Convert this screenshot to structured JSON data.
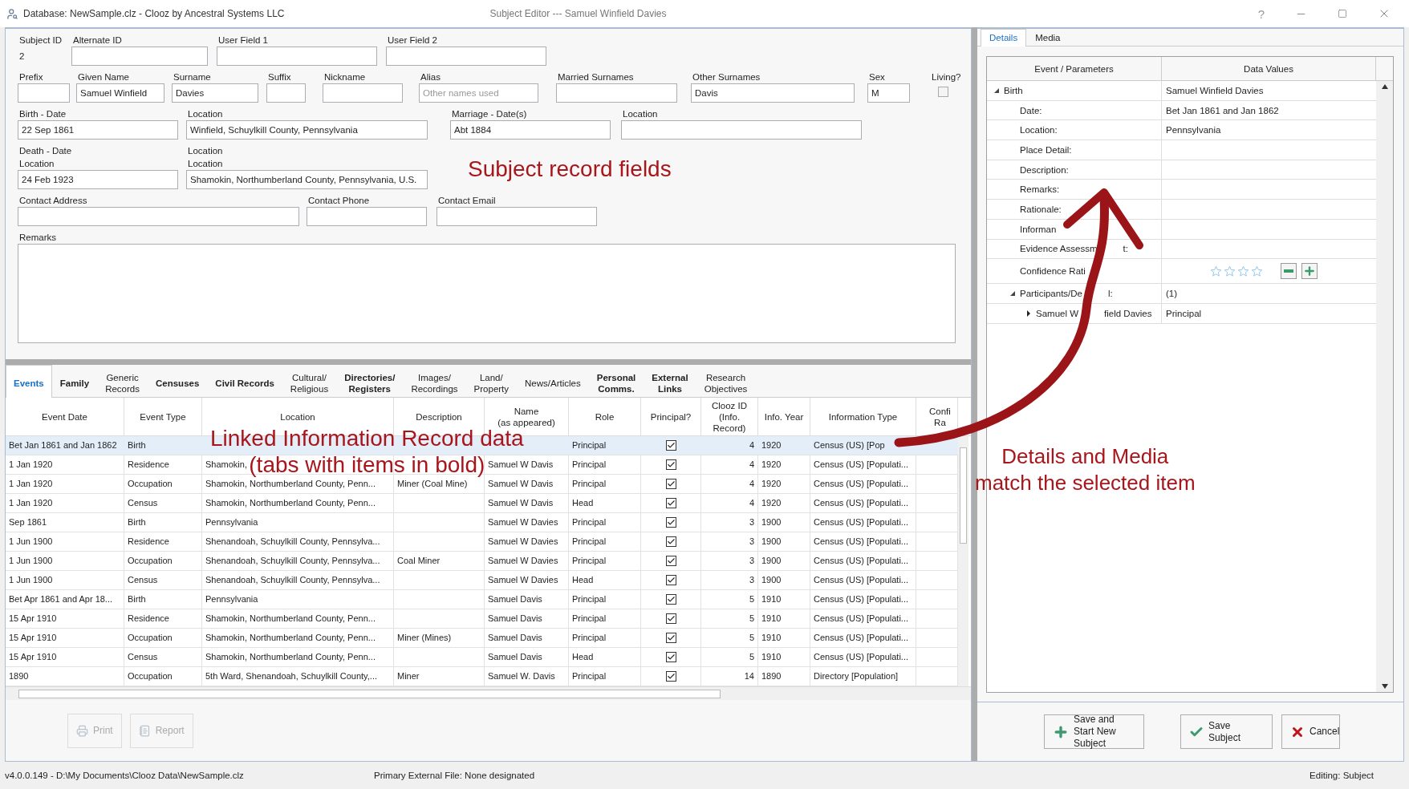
{
  "window": {
    "title": "Database: NewSample.clz - Clooz by Ancestral Systems LLC",
    "subtitle": "Subject Editor --- Samuel Winfield Davies",
    "help": "?"
  },
  "subject_form": {
    "rows": [
      [
        {
          "kind": "static",
          "label": "Subject ID",
          "value": "2"
        },
        {
          "kind": "text",
          "label": "Alternate ID"
        },
        {
          "kind": "text",
          "label": "User Field 1"
        },
        {
          "kind": "text",
          "label": "User Field 2"
        }
      ],
      [
        {
          "kind": "text",
          "label": "Prefix"
        },
        {
          "kind": "text",
          "label": "Given Name",
          "value": "Samuel Winfield"
        },
        {
          "kind": "text",
          "label": "Surname",
          "value": "Davies"
        },
        {
          "kind": "text",
          "label": "Suffix"
        },
        {
          "kind": "text",
          "label": "Nickname"
        },
        {
          "kind": "text",
          "label": "Alias",
          "placeholder": "Other names used"
        },
        {
          "kind": "text",
          "label": "Married Surnames"
        },
        {
          "kind": "text",
          "label": "Other Surnames",
          "value": "Davis"
        },
        {
          "kind": "text",
          "label": "Sex",
          "value": "M"
        },
        {
          "kind": "checkbox",
          "label": "Living?",
          "checked": false
        }
      ],
      [
        {
          "kind": "text",
          "label": "Birth - Date",
          "value": "22 Sep 1861"
        },
        {
          "kind": "text",
          "label": "Location",
          "value": "Winfield, Schuylkill County, Pennsylvania"
        },
        {
          "kind": "text",
          "label": "Marriage - Date(s)",
          "value": "Abt 1884"
        },
        {
          "kind": "text",
          "label": "Location"
        }
      ],
      [
        {
          "kind": "text",
          "label": "Death - Date",
          "sublabel": "Location",
          "value": "24 Feb 1923"
        },
        {
          "kind": "text",
          "label": "Location",
          "sublabel": "Location",
          "value": "Shamokin, Northumberland County, Pennsylvania, U.S."
        }
      ],
      [
        {
          "kind": "text",
          "label": "Contact Address"
        },
        {
          "kind": "text",
          "label": "Contact Phone"
        },
        {
          "kind": "text",
          "label": "Contact Email"
        }
      ],
      [
        {
          "kind": "textarea",
          "label": "Remarks"
        }
      ]
    ]
  },
  "annotations": [
    {
      "lines": [
        "Subject record fields"
      ]
    },
    {
      "lines": [
        "Linked Information Record data",
        "(tabs with items in bold)"
      ]
    },
    {
      "lines": [
        "Details and Media",
        "match the selected item"
      ]
    }
  ],
  "record_tabs": [
    {
      "label": "Events",
      "selected": true,
      "has_items": true
    },
    {
      "label": "Family",
      "selected": false,
      "has_items": true
    },
    {
      "label": "Generic\nRecords",
      "selected": false,
      "has_items": false
    },
    {
      "label": "Censuses",
      "selected": false,
      "has_items": true
    },
    {
      "label": "Civil Records",
      "selected": false,
      "has_items": true
    },
    {
      "label": "Cultural/\nReligious",
      "selected": false,
      "has_items": false
    },
    {
      "label": "Directories/\nRegisters",
      "selected": false,
      "has_items": true
    },
    {
      "label": "Images/\nRecordings",
      "selected": false,
      "has_items": false
    },
    {
      "label": "Land/\nProperty",
      "selected": false,
      "has_items": false
    },
    {
      "label": "News/Articles",
      "selected": false,
      "has_items": false
    },
    {
      "label": "Personal\nComms.",
      "selected": false,
      "has_items": true
    },
    {
      "label": "External\nLinks",
      "selected": false,
      "has_items": true
    },
    {
      "label": "Research\nObjectives",
      "selected": false,
      "has_items": false
    }
  ],
  "events_table": {
    "columns": [
      "Event Date",
      "Event Type",
      "Location",
      "Description",
      "Name\n(as appeared)",
      "Role",
      "Principal?",
      "Clooz ID\n(Info.\nRecord)",
      "Info. Year",
      "Information Type",
      "Confi\nRa"
    ],
    "rows": [
      {
        "selected": true,
        "event_date": "Bet Jan 1861 and Jan 1862",
        "event_type": "Birth",
        "role": "Principal",
        "principal": true,
        "clooz_id": "4",
        "info_year": "1920",
        "information_type": "Census (US) [Pop"
      },
      {
        "selected": false,
        "event_date": "1 Jan 1920",
        "event_type": "Residence",
        "location": "Shamokin,",
        "name": "Samuel W Davis",
        "role": "Principal",
        "principal": true,
        "clooz_id": "4",
        "info_year": "1920",
        "information_type": "Census (US) [Populati..."
      },
      {
        "selected": false,
        "event_date": "1 Jan 1920",
        "event_type": "Occupation",
        "location": "Shamokin, Northumberland County, Penn...",
        "description": "Miner (Coal Mine)",
        "name": "Samuel W Davis",
        "role": "Principal",
        "principal": true,
        "clooz_id": "4",
        "info_year": "1920",
        "information_type": "Census (US) [Populati..."
      },
      {
        "selected": false,
        "event_date": "1 Jan 1920",
        "event_type": "Census",
        "location": "Shamokin, Northumberland County, Penn...",
        "name": "Samuel W Davis",
        "role": "Head",
        "principal": true,
        "clooz_id": "4",
        "info_year": "1920",
        "information_type": "Census (US) [Populati..."
      },
      {
        "selected": false,
        "event_date": "Sep 1861",
        "event_type": "Birth",
        "location": "Pennsylvania",
        "name": "Samuel W Davies",
        "role": "Principal",
        "principal": true,
        "clooz_id": "3",
        "info_year": "1900",
        "information_type": "Census (US) [Populati..."
      },
      {
        "selected": false,
        "event_date": "1 Jun 1900",
        "event_type": "Residence",
        "location": "Shenandoah, Schuylkill County, Pennsylva...",
        "name": "Samuel W Davies",
        "role": "Principal",
        "principal": true,
        "clooz_id": "3",
        "info_year": "1900",
        "information_type": "Census (US) [Populati..."
      },
      {
        "selected": false,
        "event_date": "1 Jun 1900",
        "event_type": "Occupation",
        "location": "Shenandoah, Schuylkill County, Pennsylva...",
        "description": "Coal Miner",
        "name": "Samuel W Davies",
        "role": "Principal",
        "principal": true,
        "clooz_id": "3",
        "info_year": "1900",
        "information_type": "Census (US) [Populati..."
      },
      {
        "selected": false,
        "event_date": "1 Jun 1900",
        "event_type": "Census",
        "location": "Shenandoah, Schuylkill County, Pennsylva...",
        "name": "Samuel W Davies",
        "role": "Head",
        "principal": true,
        "clooz_id": "3",
        "info_year": "1900",
        "information_type": "Census (US) [Populati..."
      },
      {
        "selected": false,
        "event_date": "Bet Apr 1861 and Apr 18...",
        "event_type": "Birth",
        "location": "Pennsylvania",
        "name": "Samuel Davis",
        "role": "Principal",
        "principal": true,
        "clooz_id": "5",
        "info_year": "1910",
        "information_type": "Census (US) [Populati..."
      },
      {
        "selected": false,
        "event_date": "15 Apr 1910",
        "event_type": "Residence",
        "location": "Shamokin, Northumberland County, Penn...",
        "name": "Samuel Davis",
        "role": "Principal",
        "principal": true,
        "clooz_id": "5",
        "info_year": "1910",
        "information_type": "Census (US) [Populati..."
      },
      {
        "selected": false,
        "event_date": "15 Apr 1910",
        "event_type": "Occupation",
        "location": "Shamokin, Northumberland County, Penn...",
        "description": "Miner (Mines)",
        "name": "Samuel Davis",
        "role": "Principal",
        "principal": true,
        "clooz_id": "5",
        "info_year": "1910",
        "information_type": "Census (US) [Populati..."
      },
      {
        "selected": false,
        "event_date": "15 Apr 1910",
        "event_type": "Census",
        "location": "Shamokin, Northumberland County, Penn...",
        "name": "Samuel Davis",
        "role": "Head",
        "principal": true,
        "clooz_id": "5",
        "info_year": "1910",
        "information_type": "Census (US) [Populati..."
      },
      {
        "selected": false,
        "event_date": "1890",
        "event_type": "Occupation",
        "location": "5th Ward, Shenandoah, Schuylkill County,...",
        "description": "Miner",
        "name": "Samuel W. Davis",
        "role": "Principal",
        "principal": true,
        "clooz_id": "14",
        "info_year": "1890",
        "information_type": "Directory [Population]"
      }
    ]
  },
  "left_buttons": [
    {
      "label": "Print",
      "disabled": true
    },
    {
      "label": "Report",
      "disabled": true
    }
  ],
  "details": {
    "tabs": [
      {
        "label": "Details",
        "selected": true
      },
      {
        "label": "Media",
        "selected": false
      }
    ],
    "columns": [
      "Event / Parameters",
      "Data Values"
    ],
    "tree": [
      {
        "kind": "value",
        "label": "Birth",
        "value": "Samuel Winfield Davies",
        "expanded": true,
        "children": [
          {
            "kind": "value",
            "label": "Date:",
            "value": "Bet Jan 1861 and Jan 1862"
          },
          {
            "kind": "value",
            "label": "Location:",
            "value": "Pennsylvania"
          },
          {
            "kind": "value",
            "label": "Place Detail:"
          },
          {
            "kind": "value",
            "label": "Description:"
          },
          {
            "kind": "value",
            "label": "Remarks:"
          },
          {
            "kind": "value",
            "label": "Rationale:"
          },
          {
            "kind": "value",
            "label": "Informan"
          },
          {
            "kind": "value",
            "label": "Evidence Assessm",
            "label_end": "t:"
          },
          {
            "kind": "rating",
            "label": "Confidence Rati",
            "stars": 0
          },
          {
            "kind": "value",
            "label": "Participants/De",
            "label_end": "l:",
            "value": "(1)",
            "expanded": true,
            "children": [
              {
                "kind": "value",
                "label": "Samuel W",
                "label_end": "field Davies",
                "value": "Principal",
                "expanded": false
              }
            ]
          }
        ]
      }
    ]
  },
  "right_buttons": [
    {
      "label": "Save and Start New Subject"
    },
    {
      "label": "Save Subject"
    },
    {
      "label": "Cancel"
    }
  ],
  "status_bar": {
    "path": "v4.0.0.149  - D:\\My Documents\\Clooz Data\\NewSample.clz",
    "external_file": "Primary External File: None designated",
    "mode": "Editing: Subject"
  }
}
